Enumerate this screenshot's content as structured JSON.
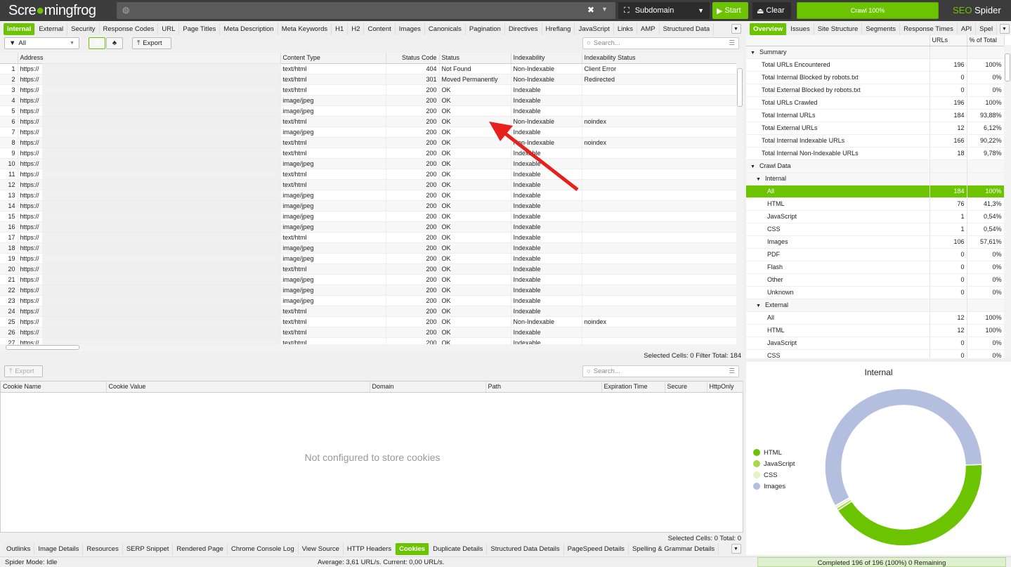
{
  "app": {
    "logo_a": "Scre",
    "logo_b": "mingfrog",
    "brand": "SEO",
    "brand2": "Spider",
    "mode": "Subdomain",
    "start": "Start",
    "clear": "Clear",
    "progress": "Crawl 100%",
    "progress_value": 100
  },
  "colors": {
    "accent": "#6cc400",
    "topbar": "#3c3c3c"
  },
  "main_tabs": [
    "Internal",
    "External",
    "Security",
    "Response Codes",
    "URL",
    "Page Titles",
    "Meta Description",
    "Meta Keywords",
    "H1",
    "H2",
    "Content",
    "Images",
    "Canonicals",
    "Pagination",
    "Directives",
    "Hreflang",
    "JavaScript",
    "Links",
    "AMP",
    "Structured Data"
  ],
  "toolbar": {
    "filter": "All",
    "export": "Export",
    "search_placeholder": "Search..."
  },
  "grid": {
    "columns": [
      "",
      "Address",
      "Content Type",
      "Status Code",
      "Status",
      "Indexability",
      "Indexability Status"
    ],
    "rows": [
      [
        "1",
        "https://",
        "text/html",
        "404",
        "Not Found",
        "Non-Indexable",
        "Client Error"
      ],
      [
        "2",
        "https://",
        "text/html",
        "301",
        "Moved Permanently",
        "Non-Indexable",
        "Redirected"
      ],
      [
        "3",
        "https://",
        "text/html",
        "200",
        "OK",
        "Indexable",
        ""
      ],
      [
        "4",
        "https://",
        "image/jpeg",
        "200",
        "OK",
        "Indexable",
        ""
      ],
      [
        "5",
        "https://",
        "image/jpeg",
        "200",
        "OK",
        "Indexable",
        ""
      ],
      [
        "6",
        "https://",
        "text/html",
        "200",
        "OK",
        "Non-Indexable",
        "noindex"
      ],
      [
        "7",
        "https://",
        "image/jpeg",
        "200",
        "OK",
        "Indexable",
        ""
      ],
      [
        "8",
        "https://",
        "text/html",
        "200",
        "OK",
        "Non-Indexable",
        "noindex"
      ],
      [
        "9",
        "https://",
        "text/html",
        "200",
        "OK",
        "Indexable",
        ""
      ],
      [
        "10",
        "https://",
        "image/jpeg",
        "200",
        "OK",
        "Indexable",
        ""
      ],
      [
        "11",
        "https://",
        "text/html",
        "200",
        "OK",
        "Indexable",
        ""
      ],
      [
        "12",
        "https://",
        "text/html",
        "200",
        "OK",
        "Indexable",
        ""
      ],
      [
        "13",
        "https://",
        "image/jpeg",
        "200",
        "OK",
        "Indexable",
        ""
      ],
      [
        "14",
        "https://",
        "image/jpeg",
        "200",
        "OK",
        "Indexable",
        ""
      ],
      [
        "15",
        "https://",
        "image/jpeg",
        "200",
        "OK",
        "Indexable",
        ""
      ],
      [
        "16",
        "https://",
        "image/jpeg",
        "200",
        "OK",
        "Indexable",
        ""
      ],
      [
        "17",
        "https://",
        "text/html",
        "200",
        "OK",
        "Indexable",
        ""
      ],
      [
        "18",
        "https://",
        "image/jpeg",
        "200",
        "OK",
        "Indexable",
        ""
      ],
      [
        "19",
        "https://",
        "image/jpeg",
        "200",
        "OK",
        "Indexable",
        ""
      ],
      [
        "20",
        "https://",
        "text/html",
        "200",
        "OK",
        "Indexable",
        ""
      ],
      [
        "21",
        "https://",
        "image/jpeg",
        "200",
        "OK",
        "Indexable",
        ""
      ],
      [
        "22",
        "https://",
        "image/jpeg",
        "200",
        "OK",
        "Indexable",
        ""
      ],
      [
        "23",
        "https://",
        "image/jpeg",
        "200",
        "OK",
        "Indexable",
        ""
      ],
      [
        "24",
        "https://",
        "text/html",
        "200",
        "OK",
        "Indexable",
        ""
      ],
      [
        "25",
        "https://",
        "text/html",
        "200",
        "OK",
        "Non-Indexable",
        "noindex"
      ],
      [
        "26",
        "https://",
        "text/html",
        "200",
        "OK",
        "Indexable",
        ""
      ],
      [
        "27",
        "https://",
        "text/html",
        "200",
        "OK",
        "Indexable",
        ""
      ]
    ],
    "footer": "Selected Cells:  0  Filter Total:  184"
  },
  "right_tabs": [
    "Overview",
    "Issues",
    "Site Structure",
    "Segments",
    "Response Times",
    "API",
    "Spel"
  ],
  "overview": {
    "columns": [
      "",
      "URLs",
      "% of Total"
    ],
    "rows": [
      {
        "label": "Summary",
        "indent": 0,
        "arrow": "▼",
        "urls": "",
        "pct": ""
      },
      {
        "label": "Total URLs Encountered",
        "indent": 2,
        "urls": "196",
        "pct": "100%"
      },
      {
        "label": "Total Internal Blocked by robots.txt",
        "indent": 2,
        "urls": "0",
        "pct": "0%"
      },
      {
        "label": "Total External Blocked by robots.txt",
        "indent": 2,
        "urls": "0",
        "pct": "0%"
      },
      {
        "label": "Total URLs Crawled",
        "indent": 2,
        "urls": "196",
        "pct": "100%"
      },
      {
        "label": "Total Internal URLs",
        "indent": 2,
        "urls": "184",
        "pct": "93,88%"
      },
      {
        "label": "Total External URLs",
        "indent": 2,
        "urls": "12",
        "pct": "6,12%"
      },
      {
        "label": "Total Internal Indexable URLs",
        "indent": 2,
        "urls": "166",
        "pct": "90,22%"
      },
      {
        "label": "Total Internal Non-Indexable URLs",
        "indent": 2,
        "urls": "18",
        "pct": "9,78%"
      },
      {
        "label": "Crawl Data",
        "indent": 0,
        "arrow": "▼",
        "urls": "",
        "pct": ""
      },
      {
        "label": "Internal",
        "indent": 1,
        "arrow": "▼",
        "urls": "",
        "pct": ""
      },
      {
        "label": "All",
        "indent": 3,
        "urls": "184",
        "pct": "100%",
        "selected": true
      },
      {
        "label": "HTML",
        "indent": 3,
        "urls": "76",
        "pct": "41,3%"
      },
      {
        "label": "JavaScript",
        "indent": 3,
        "urls": "1",
        "pct": "0,54%"
      },
      {
        "label": "CSS",
        "indent": 3,
        "urls": "1",
        "pct": "0,54%"
      },
      {
        "label": "Images",
        "indent": 3,
        "urls": "106",
        "pct": "57,61%"
      },
      {
        "label": "PDF",
        "indent": 3,
        "urls": "0",
        "pct": "0%"
      },
      {
        "label": "Flash",
        "indent": 3,
        "urls": "0",
        "pct": "0%"
      },
      {
        "label": "Other",
        "indent": 3,
        "urls": "0",
        "pct": "0%"
      },
      {
        "label": "Unknown",
        "indent": 3,
        "urls": "0",
        "pct": "0%"
      },
      {
        "label": "External",
        "indent": 1,
        "arrow": "▼",
        "urls": "",
        "pct": ""
      },
      {
        "label": "All",
        "indent": 3,
        "urls": "12",
        "pct": "100%"
      },
      {
        "label": "HTML",
        "indent": 3,
        "urls": "12",
        "pct": "100%"
      },
      {
        "label": "JavaScript",
        "indent": 3,
        "urls": "0",
        "pct": "0%"
      },
      {
        "label": "CSS",
        "indent": 3,
        "urls": "0",
        "pct": "0%"
      }
    ]
  },
  "lower": {
    "export": "Export",
    "search_placeholder": "Search...",
    "columns": [
      "Cookie Name",
      "Cookie Value",
      "Domain",
      "Path",
      "Expiration Time",
      "Secure",
      "HttpOnly"
    ],
    "empty": "Not configured to store cookies",
    "footer": "Selected Cells:  0  Total:  0"
  },
  "bottom_tabs": [
    "Outlinks",
    "Image Details",
    "Resources",
    "SERP Snippet",
    "Rendered Page",
    "Chrome Console Log",
    "View Source",
    "HTTP Headers",
    "Cookies",
    "Duplicate Details",
    "Structured Data Details",
    "PageSpeed Details",
    "Spelling & Grammar Details"
  ],
  "status": {
    "mode": "Spider Mode: Idle",
    "speed": "Average: 3,61 URL/s. Current: 0,00 URL/s.",
    "completed": "Completed 196 of 196 (100%) 0 Remaining"
  },
  "chart_data": {
    "type": "pie",
    "title": "Internal",
    "donut": true,
    "legend": "left",
    "series": [
      {
        "name": "HTML",
        "value": 76,
        "color": "#6cc400"
      },
      {
        "name": "JavaScript",
        "value": 1,
        "color": "#a8d84a"
      },
      {
        "name": "CSS",
        "value": 1,
        "color": "#e2f3c8"
      },
      {
        "name": "Images",
        "value": 106,
        "color": "#b4bfe0"
      }
    ]
  }
}
